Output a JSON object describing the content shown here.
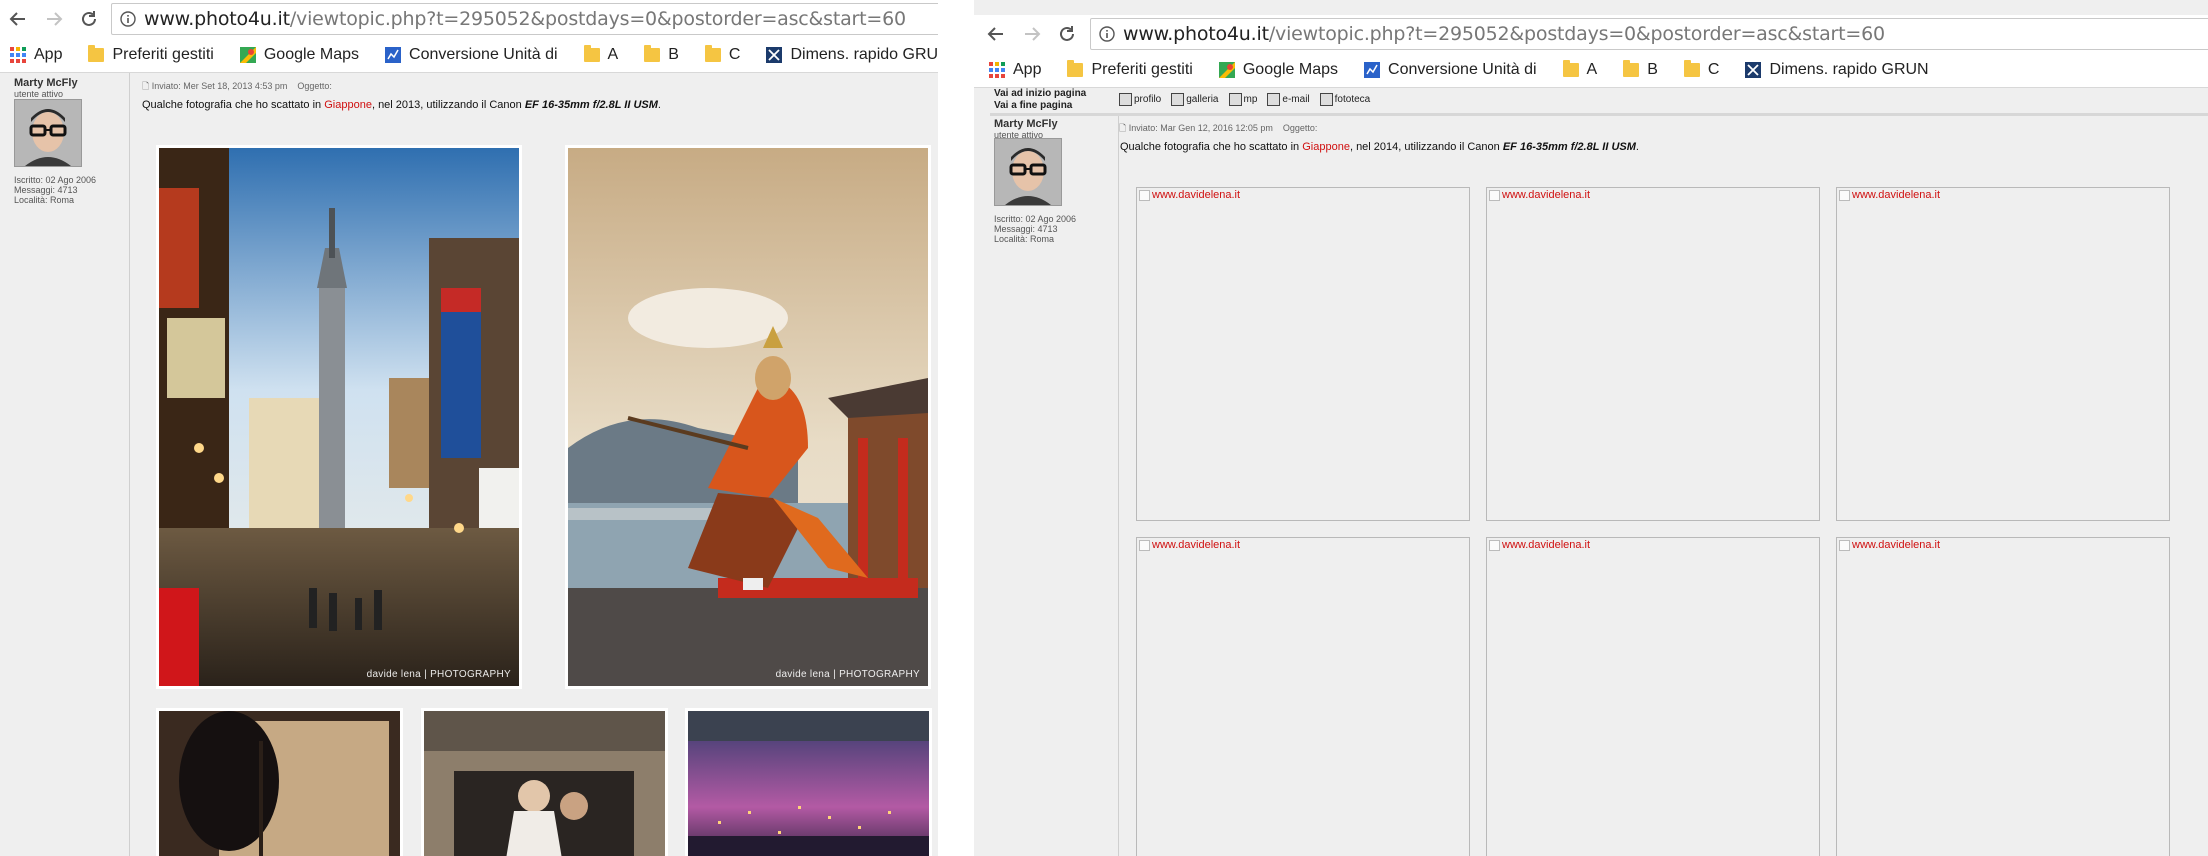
{
  "browser": {
    "url_domain": "www.photo4u.it",
    "url_path": "/viewtopic.php?t=295052&postdays=0&postorder=asc&start=60",
    "bookmarks": [
      "App",
      "Preferiti gestiti",
      "Google Maps",
      "Conversione Unità di",
      "A",
      "B",
      "C",
      "Dimens. rapido GRUN"
    ]
  },
  "left_post": {
    "author": "Marty McFly",
    "rank": "utente attivo",
    "joined": "Iscritto: 02 Ago 2006",
    "messages": "Messaggi: 4713",
    "location": "Località: Roma",
    "posted": "Inviato: Mer Set 18, 2013 4:53 pm",
    "subject": "Oggetto:",
    "body_pre": "Qualche fotografia che ho scattato in ",
    "body_country": "Giappone",
    "body_mid": ", nel 2013, utilizzando il Canon ",
    "body_lens": "EF 16-35mm f/2.8L II USM",
    "body_end": ".",
    "watermark": "davide lena | PHOTOGRAPHY"
  },
  "right_post": {
    "nav_top": "Vai ad inizio pagina",
    "nav_bottom": "Vai a fine pagina",
    "tools": [
      "profilo",
      "galleria",
      "mp",
      "e-mail",
      "fototeca"
    ],
    "author": "Marty McFly",
    "rank": "utente attivo",
    "joined": "Iscritto: 02 Ago 2006",
    "messages": "Messaggi: 4713",
    "location": "Località: Roma",
    "posted": "Inviato: Mar Gen 12, 2016 12:05 pm",
    "subject": "Oggetto:",
    "body_pre": "Qualche fotografia che ho scattato in ",
    "body_country": "Giappone",
    "body_mid": ", nel 2014, utilizzando il Canon ",
    "body_lens": "EF 16-35mm f/2.8L II USM",
    "body_end": ".",
    "broken_alt": "www.davidelena.it"
  },
  "colors": {
    "link_red": "#d01010",
    "forum_bg": "#efefef"
  }
}
